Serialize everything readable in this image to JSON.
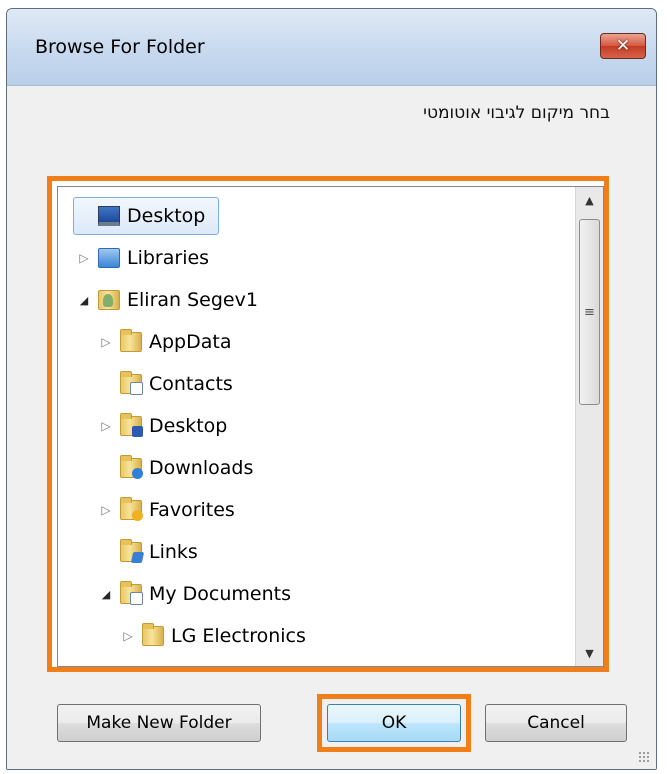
{
  "window": {
    "title": "Browse For Folder",
    "close_glyph": "✕"
  },
  "instruction": "בחר מיקום לגיבוי אוטומטי",
  "tree": {
    "items": [
      {
        "label": "Desktop",
        "level": 0,
        "expander": "none",
        "icon": "desktop-icon",
        "selected": true
      },
      {
        "label": "Libraries",
        "level": 0,
        "expander": "collapsed",
        "icon": "libraries-icon"
      },
      {
        "label": "Eliran Segev1",
        "level": 0,
        "expander": "expanded",
        "icon": "user-folder-icon"
      },
      {
        "label": "AppData",
        "level": 1,
        "expander": "collapsed",
        "icon": "folder-icon"
      },
      {
        "label": "Contacts",
        "level": 1,
        "expander": "none",
        "icon": "contacts-folder-icon"
      },
      {
        "label": "Desktop",
        "level": 1,
        "expander": "collapsed",
        "icon": "desktop-folder-icon"
      },
      {
        "label": "Downloads",
        "level": 1,
        "expander": "none",
        "icon": "downloads-folder-icon"
      },
      {
        "label": "Favorites",
        "level": 1,
        "expander": "collapsed",
        "icon": "favorites-folder-icon"
      },
      {
        "label": "Links",
        "level": 1,
        "expander": "none",
        "icon": "links-folder-icon"
      },
      {
        "label": "My Documents",
        "level": 1,
        "expander": "expanded",
        "icon": "documents-folder-icon"
      },
      {
        "label": "LG Electronics",
        "level": 2,
        "expander": "collapsed",
        "icon": "folder-icon"
      }
    ]
  },
  "buttons": {
    "make_new_folder": "Make New Folder",
    "ok": "OK",
    "cancel": "Cancel"
  },
  "highlight_color": "#f07f1a"
}
